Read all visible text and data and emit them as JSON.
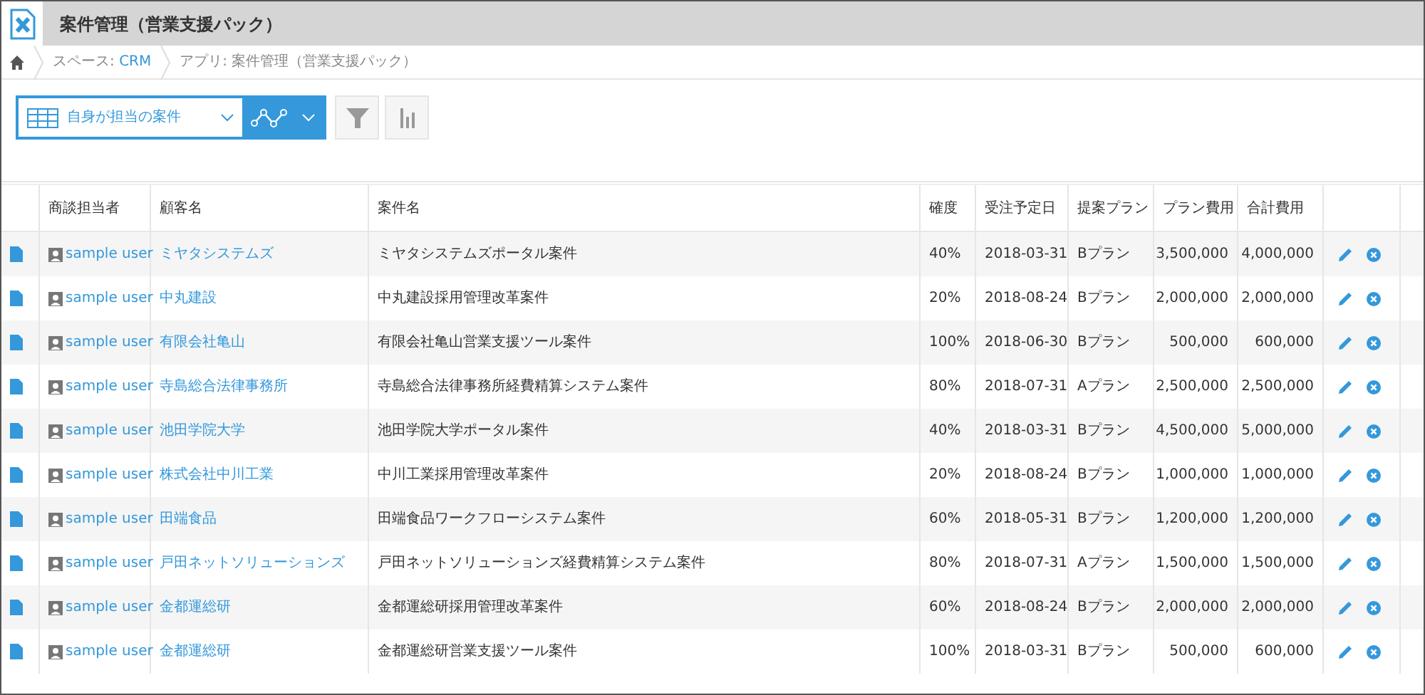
{
  "header": {
    "title": "案件管理（営業支援パック）"
  },
  "breadcrumb": [
    {
      "label": "スペース: ",
      "link": "CRM"
    },
    {
      "label": "アプリ: 案件管理（営業支援パック）"
    }
  ],
  "toolbar": {
    "view": "自身が担当の案件"
  },
  "table": {
    "columns": [
      "商談担当者",
      "顧客名",
      "案件名",
      "確度",
      "受注予定日",
      "提案プラン",
      "プラン費用",
      "合計費用"
    ],
    "rows": [
      {
        "user": "sample user",
        "customer": "ミヤタシステムズ",
        "deal": "ミヤタシステムズポータル案件",
        "prob": "40%",
        "date": "2018-03-31",
        "plan": "Bプラン",
        "cost": "3,500,000",
        "total": "4,000,000"
      },
      {
        "user": "sample user",
        "customer": "中丸建設",
        "deal": "中丸建設採用管理改革案件",
        "prob": "20%",
        "date": "2018-08-24",
        "plan": "Bプラン",
        "cost": "2,000,000",
        "total": "2,000,000"
      },
      {
        "user": "sample user",
        "customer": "有限会社亀山",
        "deal": "有限会社亀山営業支援ツール案件",
        "prob": "100%",
        "date": "2018-06-30",
        "plan": "Bプラン",
        "cost": "500,000",
        "total": "600,000"
      },
      {
        "user": "sample user",
        "customer": "寺島総合法律事務所",
        "deal": "寺島総合法律事務所経費精算システム案件",
        "prob": "80%",
        "date": "2018-07-31",
        "plan": "Aプラン",
        "cost": "2,500,000",
        "total": "2,500,000"
      },
      {
        "user": "sample user",
        "customer": "池田学院大学",
        "deal": "池田学院大学ポータル案件",
        "prob": "40%",
        "date": "2018-03-31",
        "plan": "Bプラン",
        "cost": "4,500,000",
        "total": "5,000,000"
      },
      {
        "user": "sample user",
        "customer": "株式会社中川工業",
        "deal": "中川工業採用管理改革案件",
        "prob": "20%",
        "date": "2018-08-24",
        "plan": "Bプラン",
        "cost": "1,000,000",
        "total": "1,000,000"
      },
      {
        "user": "sample user",
        "customer": "田端食品",
        "deal": "田端食品ワークフローシステム案件",
        "prob": "60%",
        "date": "2018-05-31",
        "plan": "Bプラン",
        "cost": "1,200,000",
        "total": "1,200,000"
      },
      {
        "user": "sample user",
        "customer": "戸田ネットソリューションズ",
        "deal": "戸田ネットソリューションズ経費精算システム案件",
        "prob": "80%",
        "date": "2018-07-31",
        "plan": "Aプラン",
        "cost": "1,500,000",
        "total": "1,500,000"
      },
      {
        "user": "sample user",
        "customer": "金都運総研",
        "deal": "金都運総研採用管理改革案件",
        "prob": "60%",
        "date": "2018-08-24",
        "plan": "Bプラン",
        "cost": "2,000,000",
        "total": "2,000,000"
      },
      {
        "user": "sample user",
        "customer": "金都運総研",
        "deal": "金都運総研営業支援ツール案件",
        "prob": "100%",
        "date": "2018-03-31",
        "plan": "Bプラン",
        "cost": "500,000",
        "total": "600,000"
      }
    ]
  }
}
